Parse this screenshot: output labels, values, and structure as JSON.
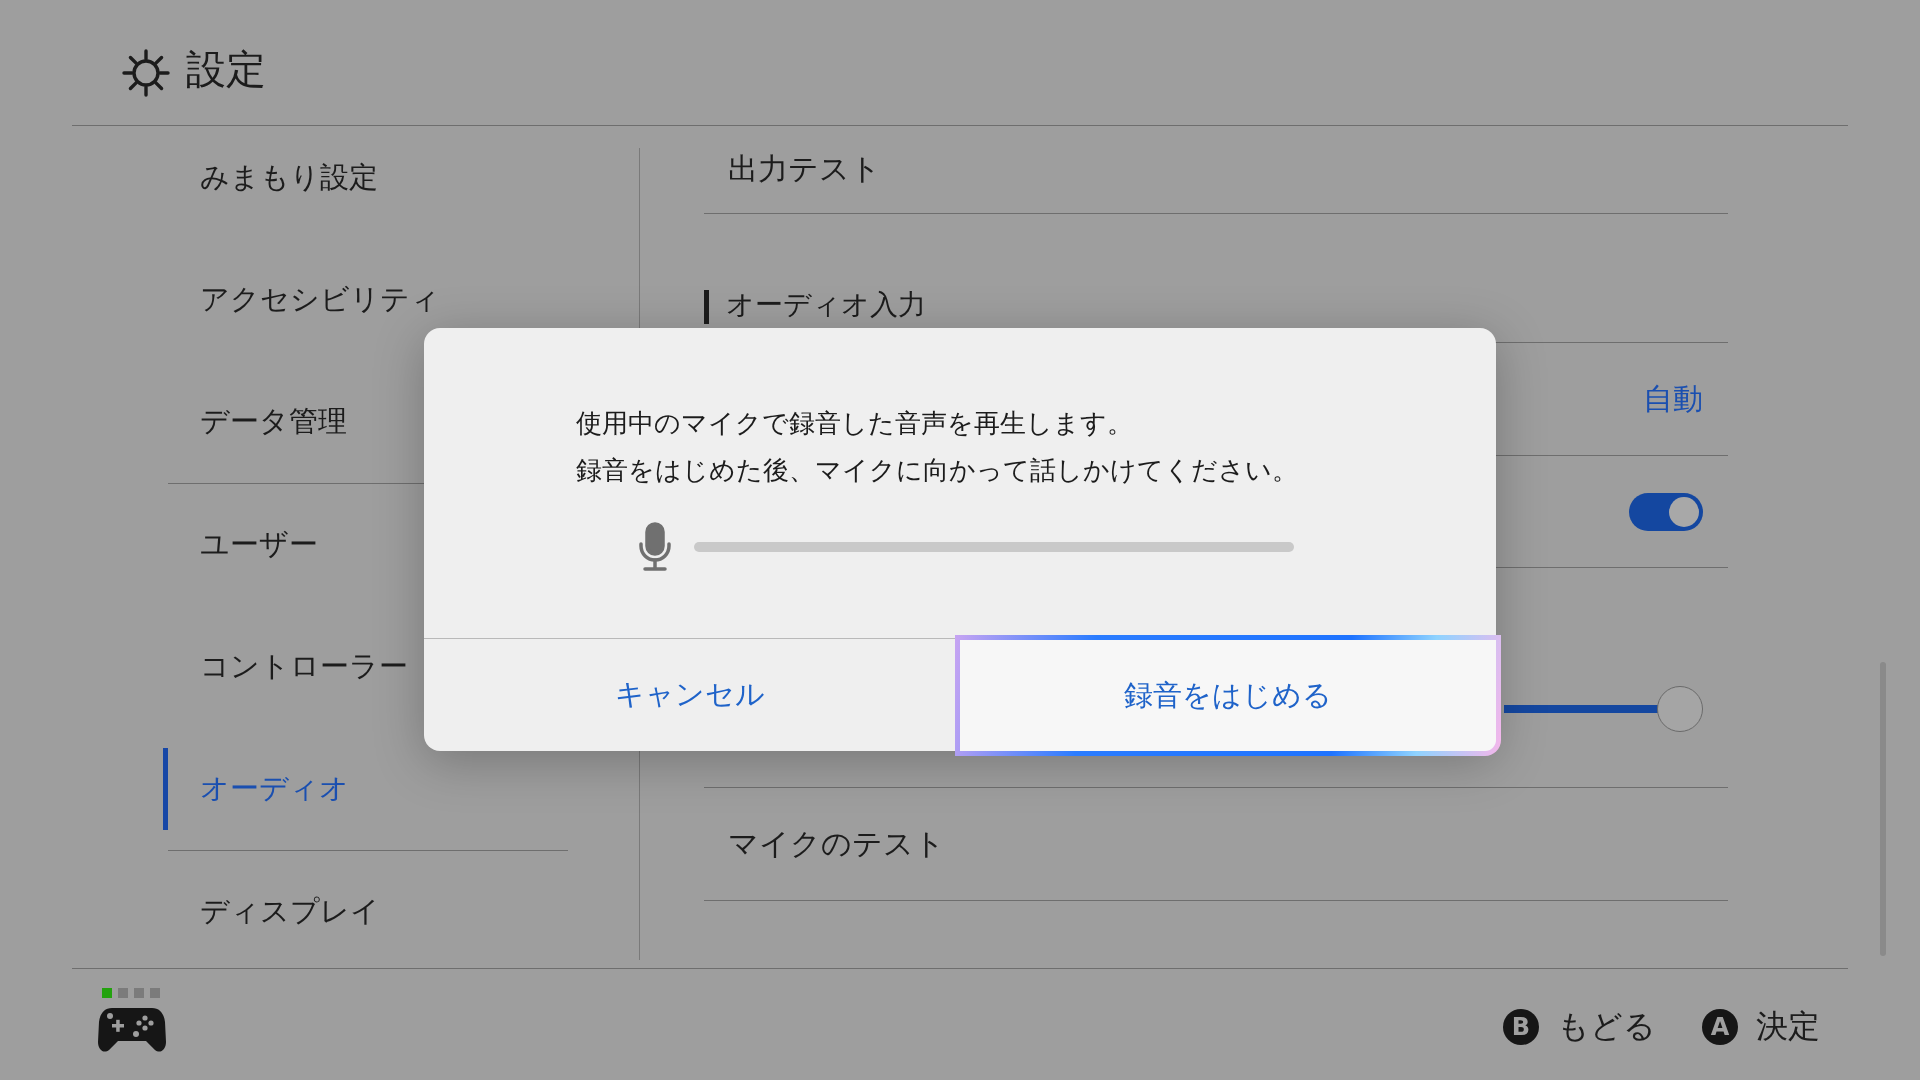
{
  "header": {
    "title": "設定"
  },
  "sidebar": {
    "groups": [
      {
        "items": [
          {
            "label": "みまもり設定",
            "selected": false
          },
          {
            "label": "アクセシビリティ",
            "selected": false
          },
          {
            "label": "データ管理",
            "selected": false
          }
        ]
      },
      {
        "items": [
          {
            "label": "ユーザー",
            "selected": false
          },
          {
            "label": "コントローラー",
            "selected": false
          },
          {
            "label": "オーディオ",
            "selected": true
          }
        ]
      },
      {
        "items": [
          {
            "label": "ディスプレイ",
            "selected": false
          }
        ]
      }
    ]
  },
  "content": {
    "rows": [
      {
        "kind": "heading",
        "label": "出力テスト"
      },
      {
        "kind": "section",
        "label": "オーディオ入力"
      },
      {
        "kind": "value",
        "value": "自動"
      },
      {
        "kind": "toggle",
        "on": true
      },
      {
        "kind": "slider",
        "level": 1
      },
      {
        "kind": "heading",
        "label": "マイクのテスト"
      }
    ]
  },
  "dialog": {
    "message": [
      "使用中のマイクで録音した音声を再生します。",
      "録音をはじめた後、マイクに向かって話しかけてください。"
    ],
    "meter": {
      "level": 0
    },
    "buttons": [
      {
        "label": "キャンセル",
        "selected": false
      },
      {
        "label": "録音をはじめる",
        "selected": true
      }
    ]
  },
  "footer": {
    "players": [
      {
        "lit": true
      },
      {
        "lit": false
      },
      {
        "lit": false
      },
      {
        "lit": false
      }
    ],
    "hints": [
      {
        "key": "B",
        "label": "もどる"
      },
      {
        "key": "A",
        "label": "決定"
      }
    ]
  }
}
